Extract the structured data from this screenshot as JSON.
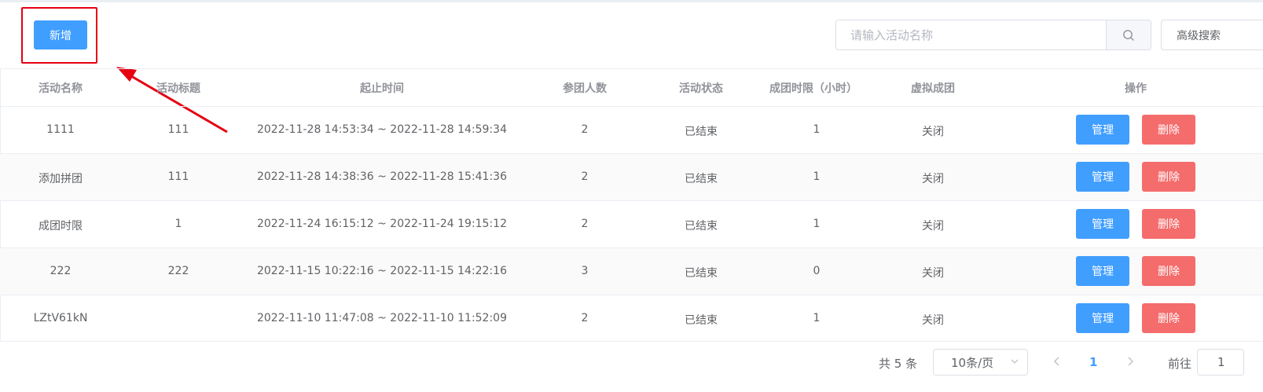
{
  "toolbar": {
    "add_label": "新增",
    "search_placeholder": "请输入活动名称",
    "advanced_label": "高级搜索"
  },
  "table": {
    "columns": [
      "活动名称",
      "活动标题",
      "起止时间",
      "参团人数",
      "活动状态",
      "成团时限（小时）",
      "虚拟成团",
      "操作"
    ],
    "rows": [
      {
        "name": "1111",
        "title": "111",
        "time": "2022-11-28 14:53:34 ~ 2022-11-28 14:59:34",
        "count": "2",
        "status": "已结束",
        "limit": "1",
        "virtual": "关闭",
        "manage": "管理",
        "delete": "删除"
      },
      {
        "name": "添加拼团",
        "title": "111",
        "time": "2022-11-28 14:38:36 ~ 2022-11-28 15:41:36",
        "count": "2",
        "status": "已结束",
        "limit": "1",
        "virtual": "关闭",
        "manage": "管理",
        "delete": "删除"
      },
      {
        "name": "成团时限",
        "title": "1",
        "time": "2022-11-24 16:15:12 ~ 2022-11-24 19:15:12",
        "count": "2",
        "status": "已结束",
        "limit": "1",
        "virtual": "关闭",
        "manage": "管理",
        "delete": "删除"
      },
      {
        "name": "222",
        "title": "222",
        "time": "2022-11-15 10:22:16 ~ 2022-11-15 14:22:16",
        "count": "3",
        "status": "已结束",
        "limit": "0",
        "virtual": "关闭",
        "manage": "管理",
        "delete": "删除"
      },
      {
        "name": "LZtV61kN",
        "title": "",
        "time": "2022-11-10 11:47:08 ~ 2022-11-10 11:52:09",
        "count": "2",
        "status": "已结束",
        "limit": "1",
        "virtual": "关闭",
        "manage": "管理",
        "delete": "删除"
      }
    ]
  },
  "pagination": {
    "total_text": "共 5 条",
    "page_size": "10条/页",
    "current_page": "1",
    "goto_label": "前往",
    "goto_value": "1"
  },
  "colors": {
    "primary": "#409eff",
    "danger": "#f56c6c",
    "annotation_red": "#e60012"
  }
}
